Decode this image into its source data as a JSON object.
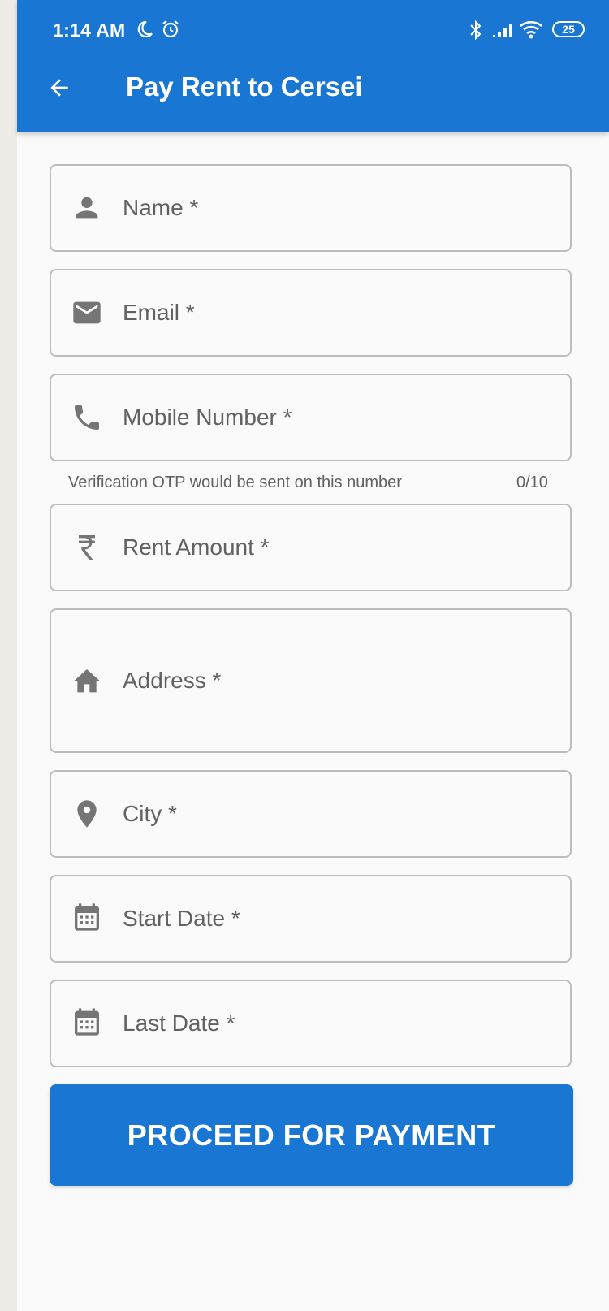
{
  "status_bar": {
    "time": "1:14 AM",
    "battery": "25",
    "icons": [
      "moon-icon",
      "alarm-icon",
      "bluetooth-icon",
      "signal-icon",
      "wifi-icon",
      "battery-icon"
    ]
  },
  "app_bar": {
    "title": "Pay Rent to Cersei",
    "back_icon": "arrow-back-icon",
    "color": "#1976d2"
  },
  "form": {
    "name": {
      "label": "Name *",
      "icon": "person-icon"
    },
    "email": {
      "label": "Email *",
      "icon": "mail-icon"
    },
    "mobile": {
      "label": "Mobile Number *",
      "icon": "phone-icon",
      "helper": "Verification OTP would be sent on this number",
      "counter": "0/10"
    },
    "rent": {
      "label": "Rent Amount *",
      "icon": "rupee-icon"
    },
    "address": {
      "label": "Address *",
      "icon": "home-icon"
    },
    "city": {
      "label": "City *",
      "icon": "location-pin-icon"
    },
    "start_date": {
      "label": "Start Date *",
      "icon": "calendar-icon"
    },
    "last_date": {
      "label": "Last Date *",
      "icon": "calendar-icon"
    }
  },
  "actions": {
    "proceed_label": "PROCEED FOR PAYMENT"
  }
}
